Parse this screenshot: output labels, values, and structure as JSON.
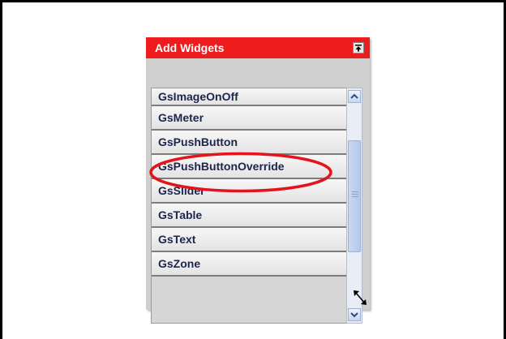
{
  "panel": {
    "title": "Add Widgets",
    "collapse_icon": "collapse-to-top-icon",
    "resize_icon": "resize-diagonal-icon"
  },
  "widget_list": {
    "items": [
      {
        "label": "GsImageOnOff"
      },
      {
        "label": "GsMeter"
      },
      {
        "label": "GsPushButton"
      },
      {
        "label": "GsPushButtonOverride"
      },
      {
        "label": "GsSlider"
      },
      {
        "label": "GsTable"
      },
      {
        "label": "GsText"
      },
      {
        "label": "GsZone"
      }
    ],
    "highlighted_item": "GsPushButtonOverride"
  },
  "scrollbar": {
    "up_icon": "scroll-up-arrow-icon",
    "down_icon": "scroll-down-arrow-icon"
  },
  "colors": {
    "titlebar": "#ee1c1c",
    "highlight_annotation": "#e3141c",
    "item_text": "#1b2550"
  }
}
